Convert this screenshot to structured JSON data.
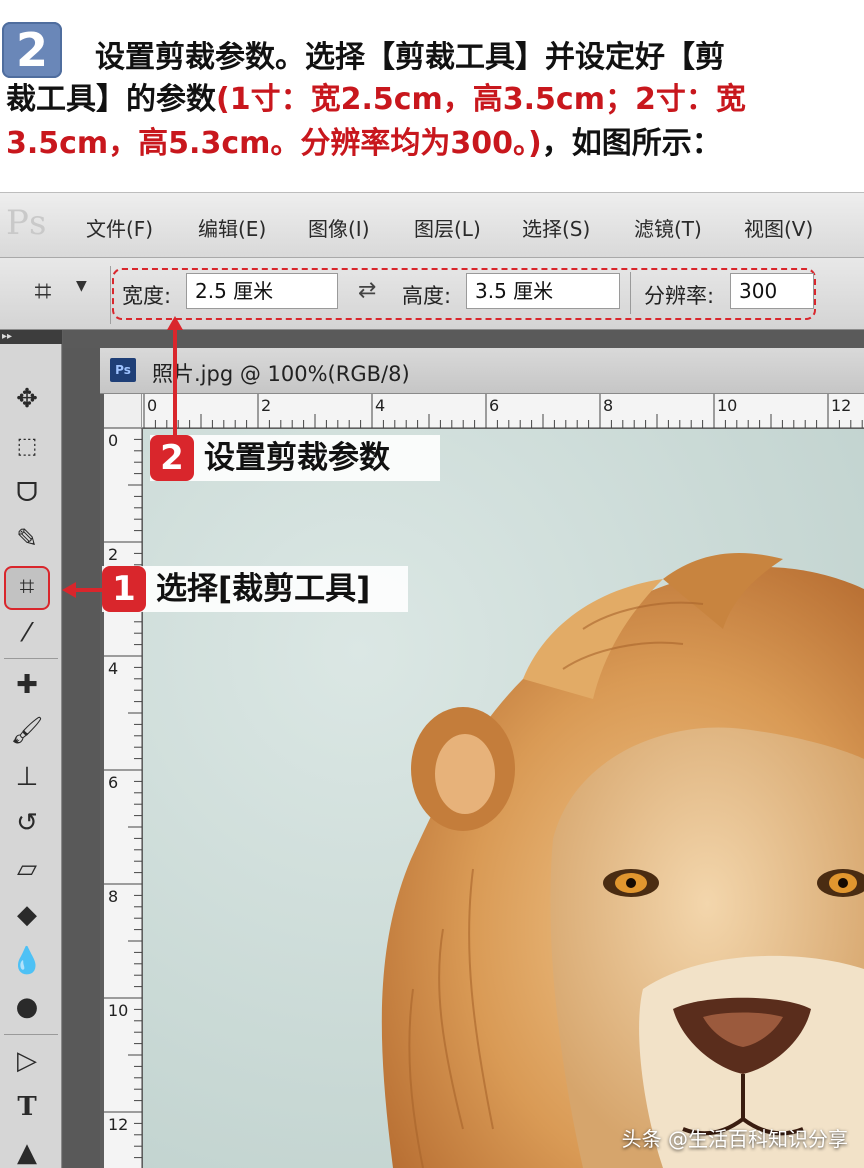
{
  "instruction": {
    "step_number": "2",
    "line1": "设置剪裁参数。选择【剪裁工具】并设定好【剪",
    "line2_black": "裁工具】的参数",
    "line2_red": "(1寸：宽2.5cm，高3.5cm；2寸：宽",
    "line3_red": "3.5cm，高5.3cm。分辨率均为300。)",
    "line3_black": "，如图所示："
  },
  "app": {
    "logo": "Ps",
    "menu": [
      "文件(F)",
      "编辑(E)",
      "图像(I)",
      "图层(L)",
      "选择(S)",
      "滤镜(T)",
      "视图(V)"
    ]
  },
  "options_bar": {
    "width_label": "宽度:",
    "width_value": "2.5 厘米",
    "height_label": "高度:",
    "height_value": "3.5 厘米",
    "resolution_label": "分辨率:",
    "resolution_value": "300"
  },
  "document": {
    "title": "照片.jpg @ 100%(RGB/8)",
    "ruler_top": [
      "0",
      "2",
      "4",
      "6",
      "8",
      "10",
      "12"
    ],
    "ruler_left": [
      "0",
      "2",
      "4",
      "6",
      "8",
      "10",
      "12"
    ]
  },
  "callouts": [
    {
      "number": "2",
      "text": "设置剪裁参数"
    },
    {
      "number": "1",
      "text": "选择[裁剪工具]"
    }
  ],
  "icons": [
    "move-icon",
    "marquee-icon",
    "lasso-icon",
    "quick-select-icon",
    "crop-icon",
    "eyedropper-icon",
    "healing-icon",
    "brush-icon",
    "stamp-icon",
    "history-brush-icon",
    "eraser-icon",
    "bucket-icon",
    "blur-icon",
    "dodge-icon",
    "path-select-icon",
    "type-icon",
    "direct-select-icon"
  ],
  "colors": {
    "accent_red": "#d9262c",
    "instruction_red": "#c8171d",
    "badge_blue": "#6a87b8"
  },
  "footer": "头条 @生活百科知识分享"
}
